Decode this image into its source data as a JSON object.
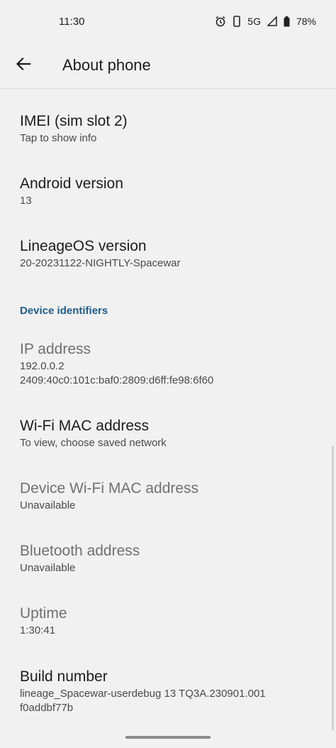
{
  "status_bar": {
    "time": "11:30",
    "network": "5G",
    "battery": "78%"
  },
  "toolbar": {
    "title": "About phone"
  },
  "items": [
    {
      "title": "IMEI (sim slot 2)",
      "summary": "Tap to show info"
    },
    {
      "title": "Android version",
      "summary": "13"
    },
    {
      "title": "LineageOS version",
      "summary": "20-20231122-NIGHTLY-Spacewar"
    }
  ],
  "category": {
    "label": "Device identifiers"
  },
  "identifiers": [
    {
      "title": "IP address",
      "summary_lines": [
        "192.0.0.2",
        "2409:40c0:101c:baf0:2809:d6ff:fe98:6f60"
      ]
    },
    {
      "title": "Wi-Fi MAC address",
      "summary": "To view, choose saved network"
    },
    {
      "title": "Device Wi-Fi MAC address",
      "summary": "Unavailable"
    },
    {
      "title": "Bluetooth address",
      "summary": "Unavailable"
    },
    {
      "title": "Uptime",
      "summary": "1:30:41"
    },
    {
      "title": "Build number",
      "summary_lines": [
        "lineage_Spacewar-userdebug 13 TQ3A.230901.001",
        "f0addbf77b"
      ]
    }
  ]
}
